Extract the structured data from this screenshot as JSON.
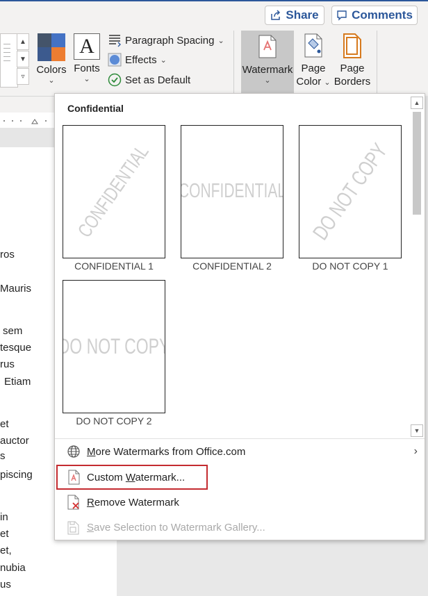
{
  "header": {
    "share_label": "Share",
    "comments_label": "Comments",
    "share_icon": "share-icon",
    "comments_icon": "comment-icon"
  },
  "ribbon": {
    "colors_label": "Colors",
    "fonts_label": "Fonts",
    "fonts_glyph": "A",
    "paragraph_spacing_label": "Paragraph Spacing",
    "effects_label": "Effects",
    "set_default_label": "Set as Default",
    "watermark_label": "Watermark",
    "page_color_label_1": "Page",
    "page_color_label_2": "Color",
    "page_borders_label_1": "Page",
    "page_borders_label_2": "Borders",
    "accent_color": "#2b579a",
    "color_swatches": [
      "#44546a",
      "#4472c4",
      "#3c5a8e",
      "#ed7d31"
    ]
  },
  "document": {
    "lines": [
      "ros",
      "Mauris",
      "sem",
      "tesque",
      "rus",
      "Etiam",
      "et",
      "auctor",
      "s",
      "piscing",
      "in",
      "et",
      "et,",
      "nubia",
      "us"
    ]
  },
  "watermark_gallery": {
    "section_title": "Confidential",
    "items": [
      {
        "caption": "CONFIDENTIAL 1",
        "watermark_text": "CONFIDENTIAL",
        "orientation": "diagonal"
      },
      {
        "caption": "CONFIDENTIAL 2",
        "watermark_text": "CONFIDENTIAL",
        "orientation": "horizontal"
      },
      {
        "caption": "DO NOT COPY 1",
        "watermark_text": "DO NOT COPY",
        "orientation": "diagonal"
      },
      {
        "caption": "DO NOT COPY 2",
        "watermark_text": "DO NOT COPY",
        "orientation": "horizontal"
      }
    ]
  },
  "menu": {
    "more_watermarks": {
      "pre": "",
      "u": "M",
      "post": "ore Watermarks from Office.com"
    },
    "custom_watermark": {
      "pre": "Custom ",
      "u": "W",
      "post": "atermark..."
    },
    "remove_watermark": {
      "pre": "",
      "u": "R",
      "post": "emove Watermark"
    },
    "save_selection": {
      "pre": "",
      "u": "S",
      "post": "ave Selection to Watermark Gallery..."
    }
  }
}
